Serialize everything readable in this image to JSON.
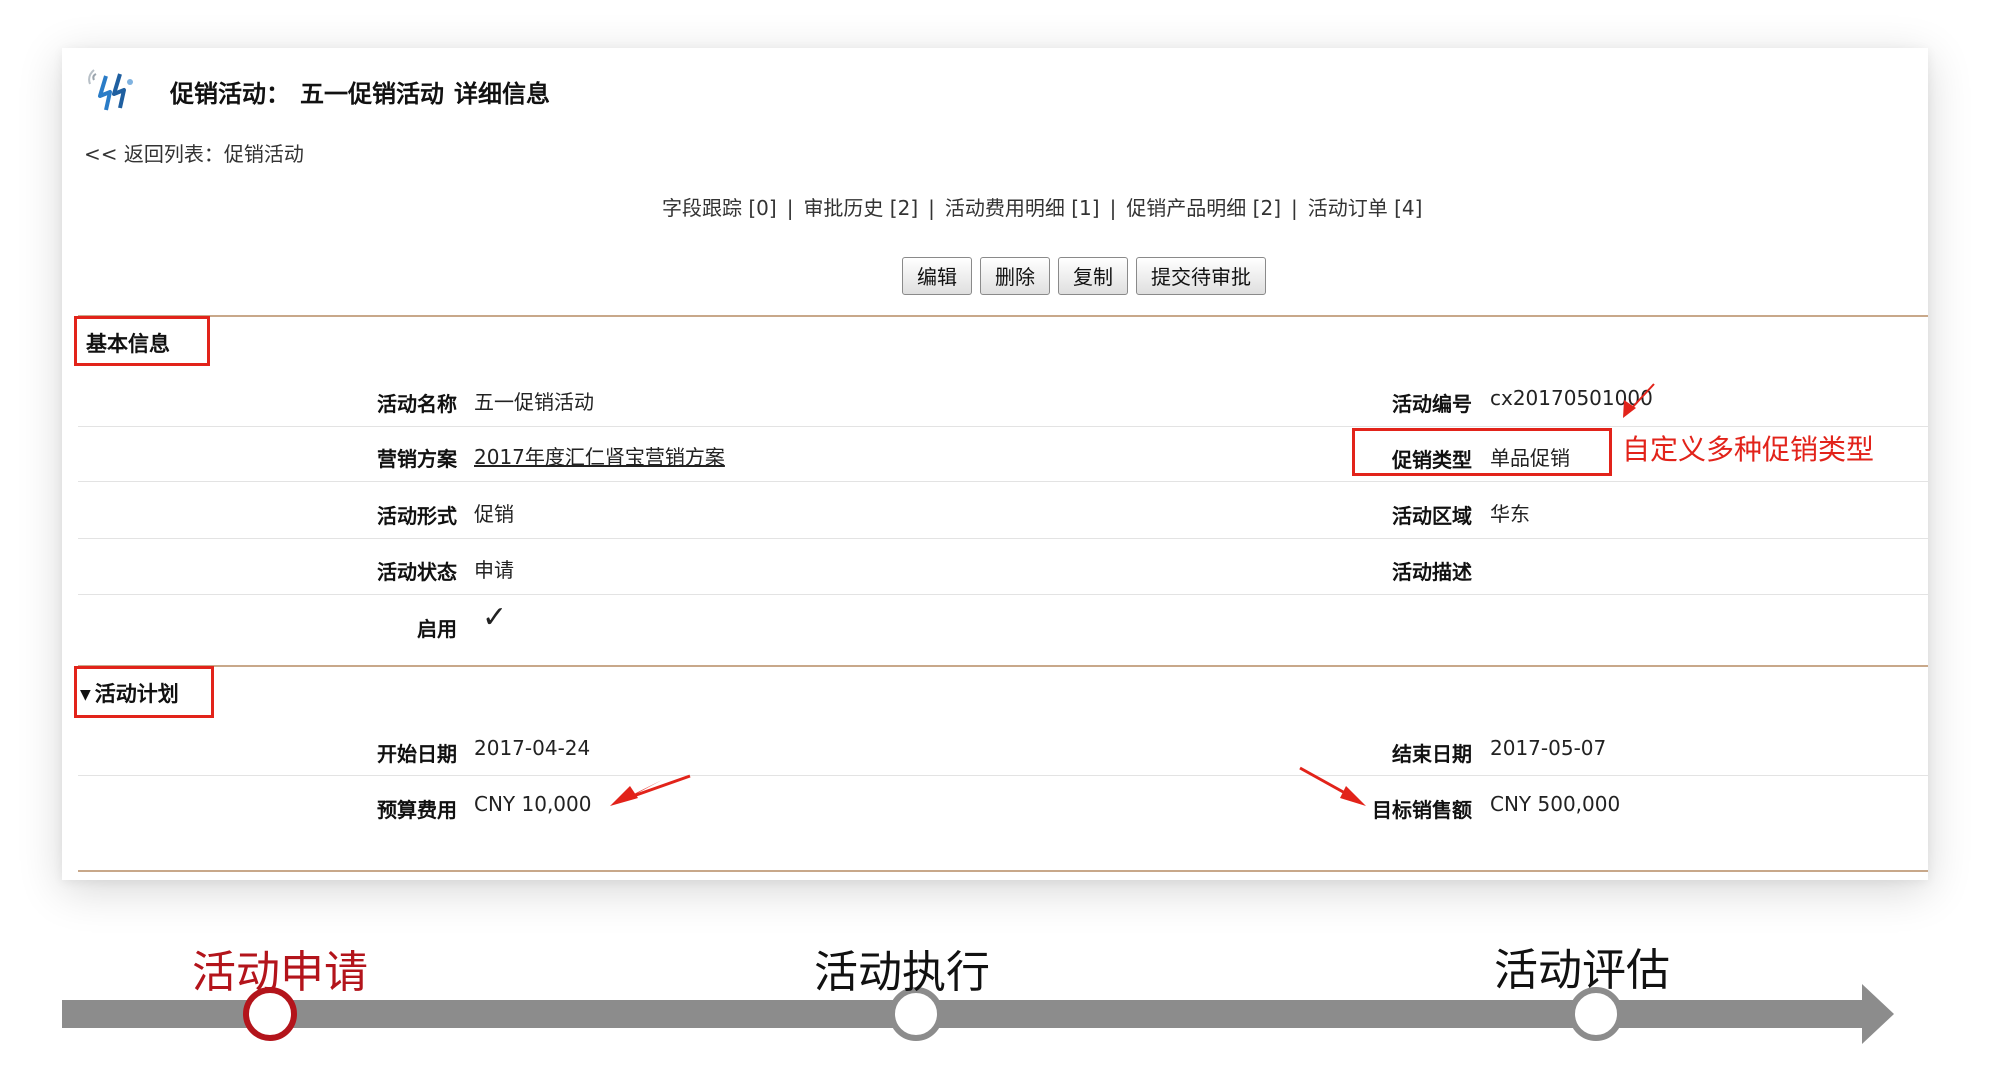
{
  "header": {
    "title_prefix": "促销活动：",
    "title_name": "五一促销活动",
    "title_suffix": "详细信息",
    "back_link": "<< 返回列表：促销活动"
  },
  "related_links": [
    "字段跟踪 [0]",
    "审批历史 [2]",
    "活动费用明细 [1]",
    "促销产品明细 [2]",
    "活动订单 [4]"
  ],
  "link_separator": "|",
  "buttons": {
    "edit": "编辑",
    "delete": "删除",
    "copy": "复制",
    "submit": "提交待审批"
  },
  "sections": {
    "basic": {
      "title": "基本信息",
      "fields": {
        "name_label": "活动名称",
        "name_value": "五一促销活动",
        "code_label": "活动编号",
        "code_value": "cx20170501000",
        "plan_label": "营销方案",
        "plan_value": "2017年度汇仁肾宝营销方案",
        "type_label": "促销类型",
        "type_value": "单品促销",
        "form_label": "活动形式",
        "form_value": "促销",
        "region_label": "活动区域",
        "region_value": "华东",
        "status_label": "活动状态",
        "status_value": "申请",
        "desc_label": "活动描述",
        "enabled_label": "启用",
        "enabled_mark": "✓"
      }
    },
    "plan": {
      "title": "活动计划",
      "toggle": "▼",
      "fields": {
        "start_label": "开始日期",
        "start_value": "2017-04-24",
        "end_label": "结束日期",
        "end_value": "2017-05-07",
        "budget_label": "预算费用",
        "budget_value": "CNY 10,000",
        "target_label": "目标销售额",
        "target_value": "CNY 500,000"
      }
    }
  },
  "annotation": "自定义多种促销类型",
  "timeline": {
    "stages": [
      "活动申请",
      "活动执行",
      "活动评估"
    ],
    "active_index": 0
  },
  "colors": {
    "accent_red": "#e2231a",
    "stage_active": "#b3141b",
    "timeline_gray": "#8c8c8c",
    "divider": "#c8a88a"
  },
  "icons": [
    "app-logo-icon",
    "checkmark-icon",
    "triangle-down-icon",
    "arrow-right-icon"
  ]
}
